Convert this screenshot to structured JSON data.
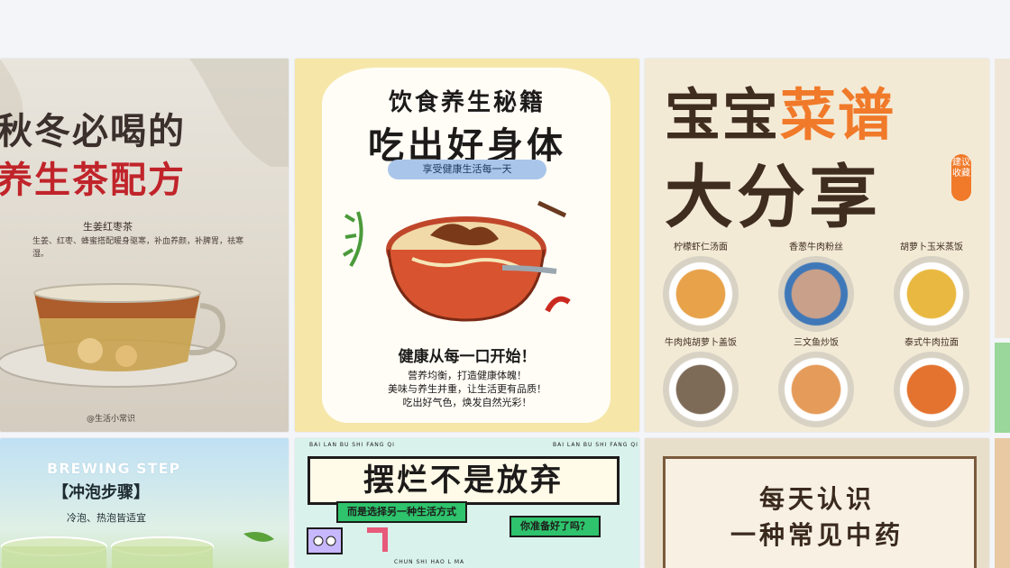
{
  "cards": {
    "tea": {
      "title_line1": "秋冬必喝的",
      "title_line2": "养生茶配方",
      "subtitle": "生姜红枣茶",
      "desc": "生姜、红枣、蜂蜜搭配暖身驱寒，补血养颜，补脾胃，祛寒湿。",
      "handle": "@生活小常识",
      "accent": "#c0242a"
    },
    "diet": {
      "heading1": "饮食养生秘籍",
      "heading2": "吃出好身体",
      "pill": "享受健康生活每一天",
      "slogan": "健康从每一口开始！",
      "line1": "营养均衡，打造健康体魄！",
      "line2": "美味与养生并重，让生活更有品质！",
      "line3": "吃出好气色，焕发自然光彩！"
    },
    "baby": {
      "title_a1": "宝宝",
      "title_a2": "菜谱",
      "title_b": "大分享",
      "tag": "建议收藏",
      "dishes": [
        {
          "label": "柠檬虾仁汤面",
          "color": "#e7a24a"
        },
        {
          "label": "香葱牛肉粉丝",
          "color": "#c9a08a"
        },
        {
          "label": "胡萝卜玉米蒸饭",
          "color": "#e9b840"
        },
        {
          "label": "牛肉炖胡萝卜盖饭",
          "color": "#7d6a57"
        },
        {
          "label": "三文鱼炒饭",
          "color": "#e59b5a"
        },
        {
          "label": "泰式牛肉拉面",
          "color": "#e3732f"
        }
      ]
    },
    "brew": {
      "en": "BREWING STEP",
      "zh": "【冲泡步骤】",
      "sub": "冷泡、热泡皆适宜"
    },
    "notgiveup": {
      "top_left": "BAI LAN BU SHI FANG QI",
      "top_right": "BAI LAN BU SHI FANG QI",
      "title": "摆烂不是放弃",
      "tag1": "而是选择另一种生活方式",
      "tag2": "你准备好了吗？",
      "bottom": "CHUN SHI HAO L MA"
    },
    "medicine": {
      "line1": "每天认识",
      "line2": "一种常见中药"
    }
  }
}
